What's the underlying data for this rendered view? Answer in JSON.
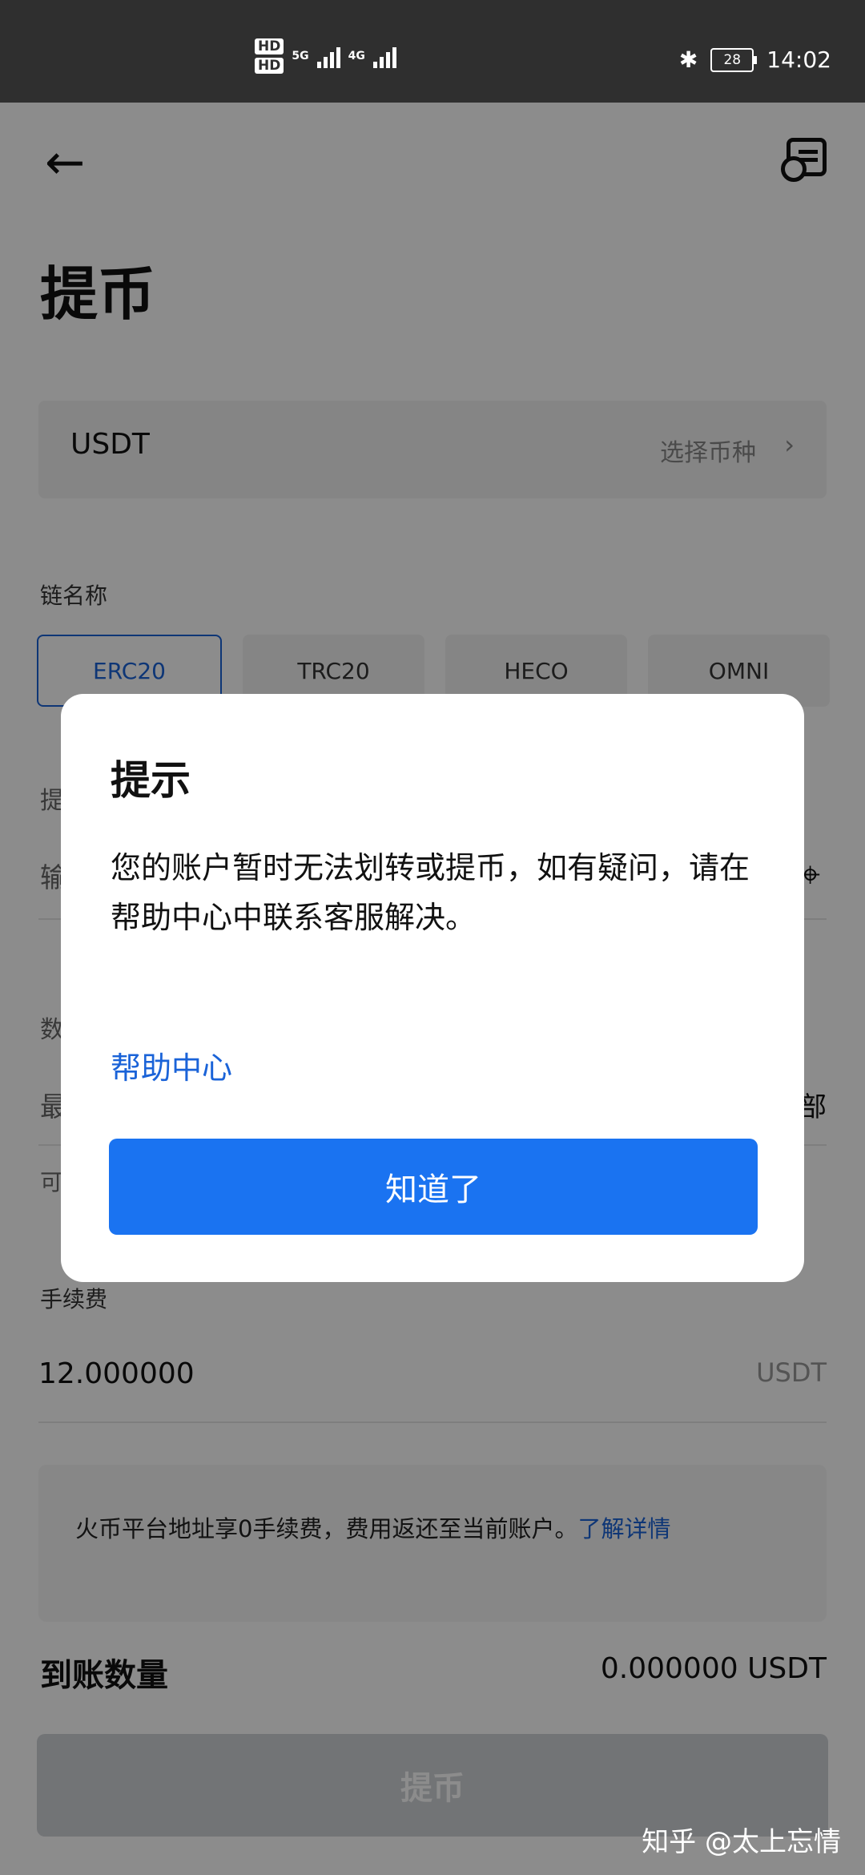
{
  "status_bar": {
    "hd1": "HD",
    "hd2": "HD",
    "net1": "5G",
    "net2": "4G",
    "battery": "28",
    "time": "14:02"
  },
  "header": {
    "back_icon": "←",
    "title": "提币"
  },
  "coin": {
    "name": "USDT",
    "select_label": "选择币种",
    "chevron": "›"
  },
  "chain": {
    "label": "链名称",
    "options": [
      {
        "label": "ERC20",
        "active": true
      },
      {
        "label": "TRC20",
        "active": false
      },
      {
        "label": "HECO",
        "active": false
      },
      {
        "label": "OMNI",
        "active": false
      }
    ]
  },
  "partial_labels": {
    "address": "提",
    "address_hint": "输",
    "amount": "数",
    "amount_hint": "最",
    "available": "可",
    "all": "部"
  },
  "fee": {
    "label": "手续费",
    "value": "12.000000",
    "unit": "USDT"
  },
  "notice": {
    "text": "火币平台地址享0手续费，费用返还至当前账户。",
    "link": "了解详情"
  },
  "arrival": {
    "label": "到账数量",
    "value": "0.000000 USDT"
  },
  "submit": {
    "label": "提币"
  },
  "dialog": {
    "title": "提示",
    "message": "您的账户暂时无法划转或提币，如有疑问，请在帮助中心中联系客服解决。",
    "link": "帮助中心",
    "confirm": "知道了"
  },
  "watermark": "知乎 @太上忘情",
  "colors": {
    "accent": "#1a73f1",
    "link": "#1a63d8",
    "status_bar": "#2f2f2f"
  }
}
